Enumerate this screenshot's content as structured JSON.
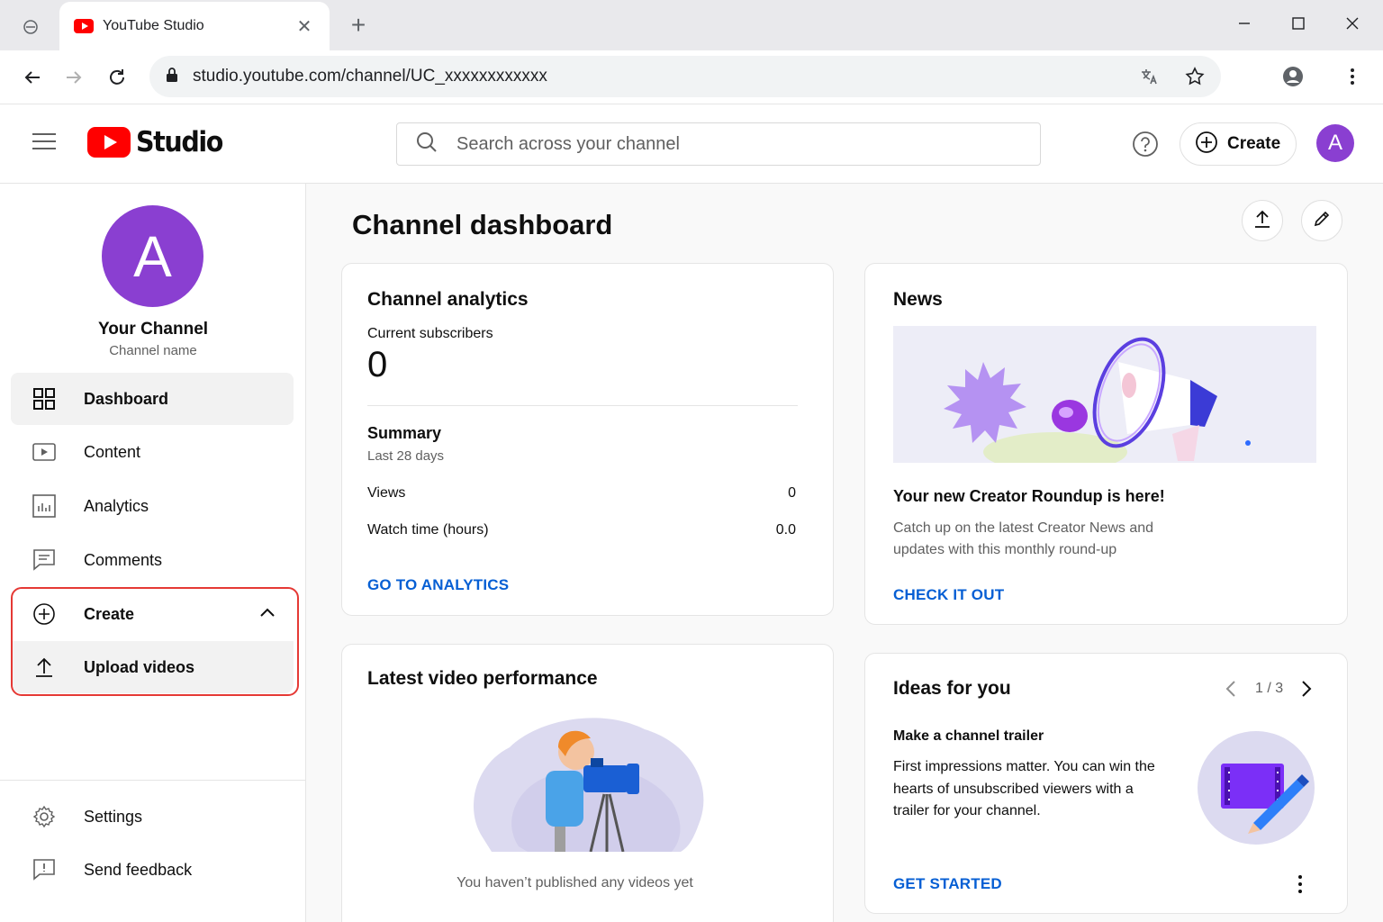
{
  "browser": {
    "tab_title": "YouTube Studio",
    "url": "studio.youtube.com/channel/UC_xxxxxxxxxxxx"
  },
  "header": {
    "logo_text": "Studio",
    "search_placeholder": "Search across your channel",
    "create_label": "Create",
    "avatar_letter": "A"
  },
  "sidebar": {
    "avatar_letter": "A",
    "channel_title": "Your Channel",
    "channel_name": "Channel name",
    "items": {
      "dashboard": "Dashboard",
      "content": "Content",
      "analytics": "Analytics",
      "comments": "Comments",
      "create": "Create",
      "upload": "Upload videos",
      "settings": "Settings",
      "feedback": "Send feedback"
    }
  },
  "main": {
    "page_title": "Channel dashboard",
    "analytics_card": {
      "title": "Channel analytics",
      "subscribers_label": "Current subscribers",
      "subscribers_value": "0",
      "summary_title": "Summary",
      "summary_period": "Last 28 days",
      "views_label": "Views",
      "views_value": "0",
      "watch_label": "Watch time (hours)",
      "watch_value": "0.0",
      "link": "GO TO ANALYTICS"
    },
    "video_card": {
      "title": "Latest video performance",
      "empty_text": "You haven’t published any videos yet"
    },
    "news_card": {
      "title": "News",
      "headline": "Your new Creator Roundup is here!",
      "body_line1": "Catch up on the latest Creator News and",
      "body_line2": "updates with this monthly round-up",
      "link": "CHECK IT OUT"
    },
    "ideas_card": {
      "title": "Ideas for you",
      "pager": "1 / 3",
      "item_title": "Make a channel trailer",
      "body_line1": "First impressions matter. You can win the",
      "body_line2": "hearts of unsubscribed viewers with a",
      "body_line3": "trailer for your channel.",
      "link": "GET STARTED"
    }
  },
  "colors": {
    "brand_red": "#ff0000",
    "link_blue": "#065fd4",
    "avatar_purple": "#8a3fd1",
    "highlight_red": "#e53935"
  }
}
